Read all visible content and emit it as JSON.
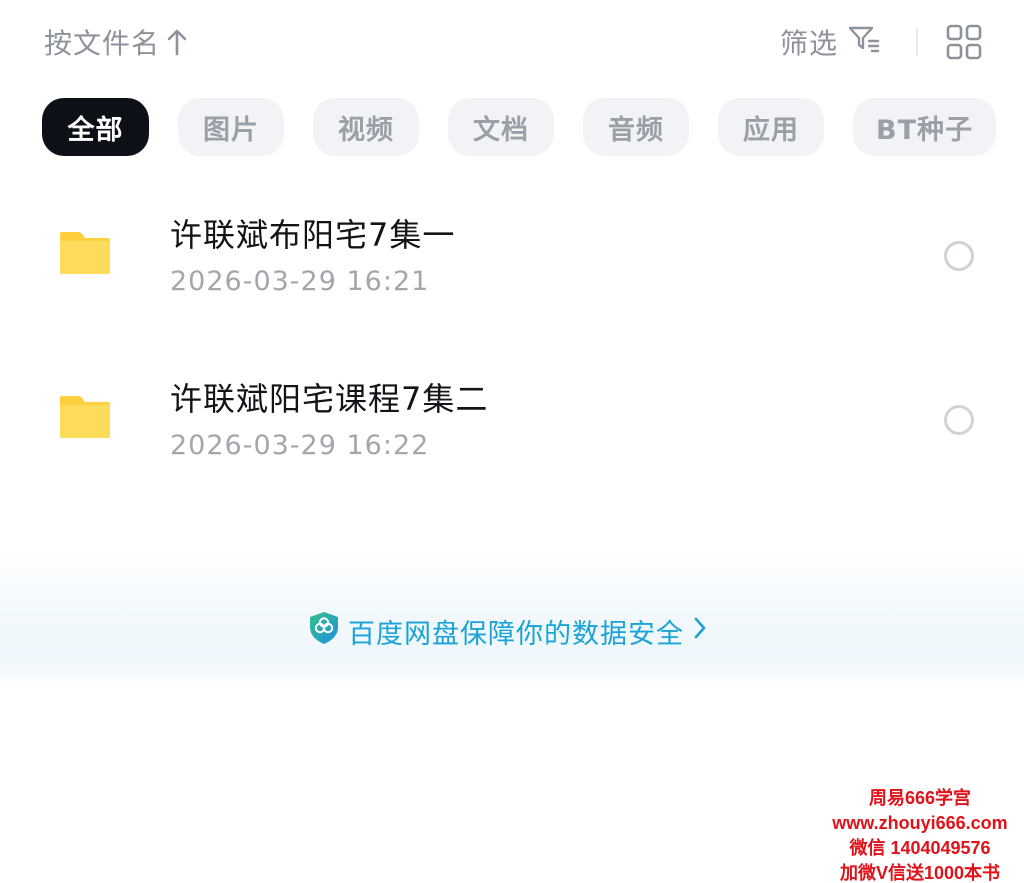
{
  "toolbar": {
    "sort_label": "按文件名",
    "filter_label": "筛选"
  },
  "categories": [
    {
      "label": "全部",
      "active": true
    },
    {
      "label": "图片",
      "active": false
    },
    {
      "label": "视频",
      "active": false
    },
    {
      "label": "文档",
      "active": false
    },
    {
      "label": "音频",
      "active": false
    },
    {
      "label": "应用",
      "active": false
    },
    {
      "label": "BT种子",
      "active": false
    }
  ],
  "files": [
    {
      "name": "许联斌布阳宅7集一",
      "date": "2026-03-29  16:21",
      "icon": "folder-icon"
    },
    {
      "name": "许联斌阳宅课程7集二",
      "date": "2026-03-29  16:22",
      "icon": "folder-icon"
    }
  ],
  "banner": {
    "text": "百度网盘保障你的数据安全"
  },
  "watermark": {
    "line1": "周易666学宫",
    "line2": "www.zhouyi666.com",
    "line3": "微信 1404049576",
    "line4": "加微V信送1000本书"
  },
  "colors": {
    "accent": "#1aa3d6",
    "active_chip": "#0d1117",
    "folder": "#ffd24a",
    "watermark": "#e0121a"
  }
}
